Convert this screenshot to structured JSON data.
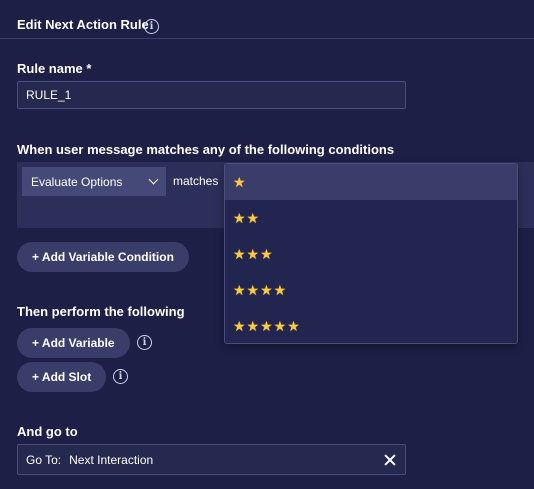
{
  "header": {
    "title": "Edit Next Action Rule",
    "info_icon": "info-icon"
  },
  "rule_name": {
    "label": "Rule name *",
    "value": "RULE_1"
  },
  "conditions": {
    "label": "When user message matches any of the following conditions",
    "select_value": "Evaluate Options",
    "operator": "matches",
    "add_variable_condition": "+ Add Variable Condition"
  },
  "dropdown": {
    "options": [
      {
        "stars": 1,
        "label": "★"
      },
      {
        "stars": 2,
        "label": "★★"
      },
      {
        "stars": 3,
        "label": "★★★"
      },
      {
        "stars": 4,
        "label": "★★★★"
      },
      {
        "stars": 5,
        "label": "★★★★★"
      }
    ],
    "highlighted_index": 0
  },
  "actions": {
    "label": "Then perform the following",
    "add_variable": "+ Add Variable",
    "add_slot": "+ Add Slot"
  },
  "goto": {
    "label": "And go to",
    "prefix": "Go To:",
    "value": "Next Interaction"
  },
  "colors": {
    "background": "#1d1f47",
    "input_bg": "#25284f",
    "pill_bg": "#3a3d6a",
    "star": "#f9c947"
  }
}
